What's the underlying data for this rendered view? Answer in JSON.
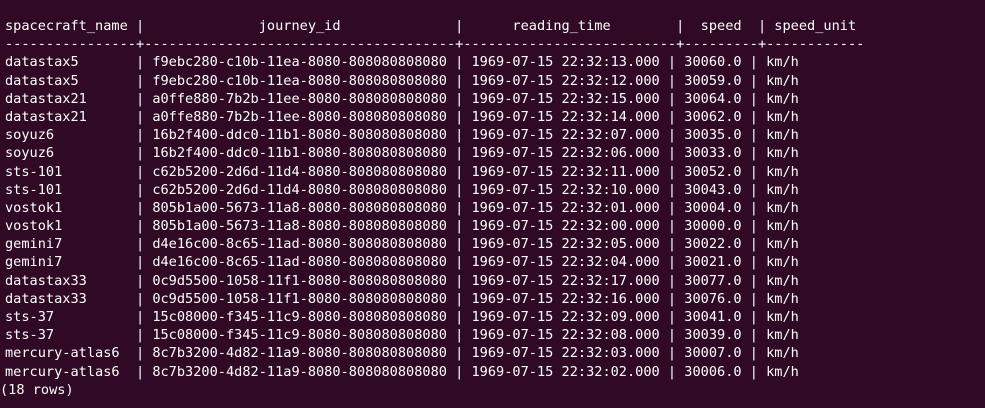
{
  "header_line": "spacecraft_name |              journey_id              |      reading_time        |  speed  | speed_unit",
  "separator_line": "----------------+--------------------------------------+--------------------------+---------+------------",
  "rows": [
    "datastax5       | f9ebc280-c10b-11ea-8080-808080808080 | 1969-07-15 22:32:13.000 | 30060.0 | km/h",
    "datastax5       | f9ebc280-c10b-11ea-8080-808080808080 | 1969-07-15 22:32:12.000 | 30059.0 | km/h",
    "datastax21      | a0ffe880-7b2b-11ee-8080-808080808080 | 1969-07-15 22:32:15.000 | 30064.0 | km/h",
    "datastax21      | a0ffe880-7b2b-11ee-8080-808080808080 | 1969-07-15 22:32:14.000 | 30062.0 | km/h",
    "soyuz6          | 16b2f400-ddc0-11b1-8080-808080808080 | 1969-07-15 22:32:07.000 | 30035.0 | km/h",
    "soyuz6          | 16b2f400-ddc0-11b1-8080-808080808080 | 1969-07-15 22:32:06.000 | 30033.0 | km/h",
    "sts-101         | c62b5200-2d6d-11d4-8080-808080808080 | 1969-07-15 22:32:11.000 | 30052.0 | km/h",
    "sts-101         | c62b5200-2d6d-11d4-8080-808080808080 | 1969-07-15 22:32:10.000 | 30043.0 | km/h",
    "vostok1         | 805b1a00-5673-11a8-8080-808080808080 | 1969-07-15 22:32:01.000 | 30004.0 | km/h",
    "vostok1         | 805b1a00-5673-11a8-8080-808080808080 | 1969-07-15 22:32:00.000 | 30000.0 | km/h",
    "gemini7         | d4e16c00-8c65-11ad-8080-808080808080 | 1969-07-15 22:32:05.000 | 30022.0 | km/h",
    "gemini7         | d4e16c00-8c65-11ad-8080-808080808080 | 1969-07-15 22:32:04.000 | 30021.0 | km/h",
    "datastax33      | 0c9d5500-1058-11f1-8080-808080808080 | 1969-07-15 22:32:17.000 | 30077.0 | km/h",
    "datastax33      | 0c9d5500-1058-11f1-8080-808080808080 | 1969-07-15 22:32:16.000 | 30076.0 | km/h",
    "sts-37          | 15c08000-f345-11c9-8080-808080808080 | 1969-07-15 22:32:09.000 | 30041.0 | km/h",
    "sts-37          | 15c08000-f345-11c9-8080-808080808080 | 1969-07-15 22:32:08.000 | 30039.0 | km/h",
    "mercury-atlas6  | 8c7b3200-4d82-11a9-8080-808080808080 | 1969-07-15 22:32:03.000 | 30007.0 | km/h",
    "mercury-atlas6  | 8c7b3200-4d82-11a9-8080-808080808080 | 1969-07-15 22:32:02.000 | 30006.0 | km/h"
  ],
  "footer": "(18 rows)",
  "colors": {
    "background": "#300a24",
    "text": "#ffffff"
  }
}
